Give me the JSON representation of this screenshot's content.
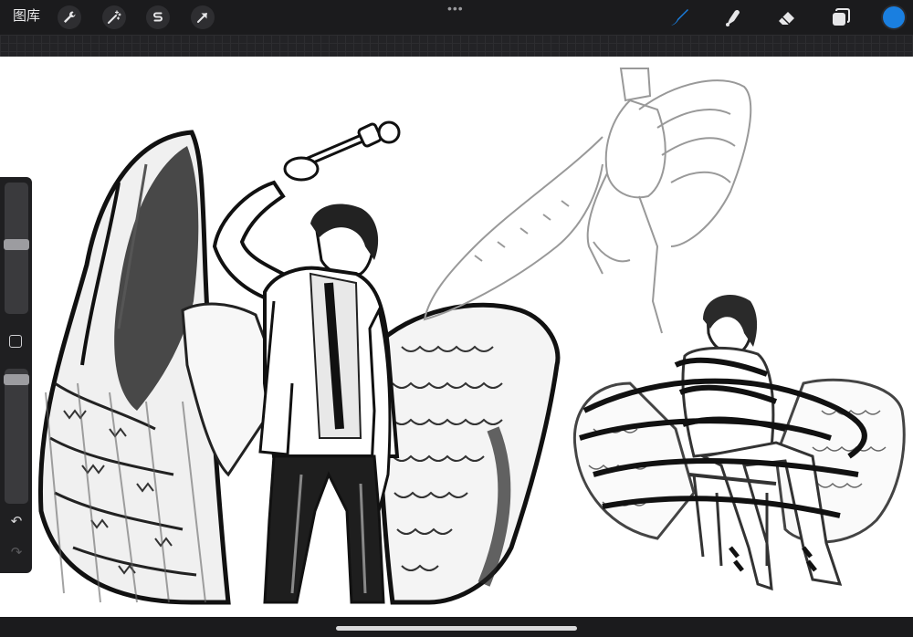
{
  "app": {
    "gallery_label": "图库",
    "more_menu": "•••"
  },
  "toolbar_left": [
    {
      "name": "wrench-icon",
      "label": "actions"
    },
    {
      "name": "magic-wand-icon",
      "label": "adjustments"
    },
    {
      "name": "selection-s-icon",
      "label": "selection"
    },
    {
      "name": "transform-arrow-icon",
      "label": "transform"
    }
  ],
  "toolbar_right": {
    "brush": "brush-icon",
    "smudge": "smudge-icon",
    "eraser": "eraser-icon",
    "layers": "layers-icon",
    "current_color": "#1a7fe0",
    "active_tool": "brush"
  },
  "sidebar": {
    "brush_size_level": 0.55,
    "opacity_level": 0.9,
    "undo_icon": "↶",
    "redo_icon": "↷"
  },
  "colors": {
    "accent": "#1a7fe0",
    "toolbar_bg": "#1b1b1d",
    "canvas_bg": "#ffffff"
  }
}
